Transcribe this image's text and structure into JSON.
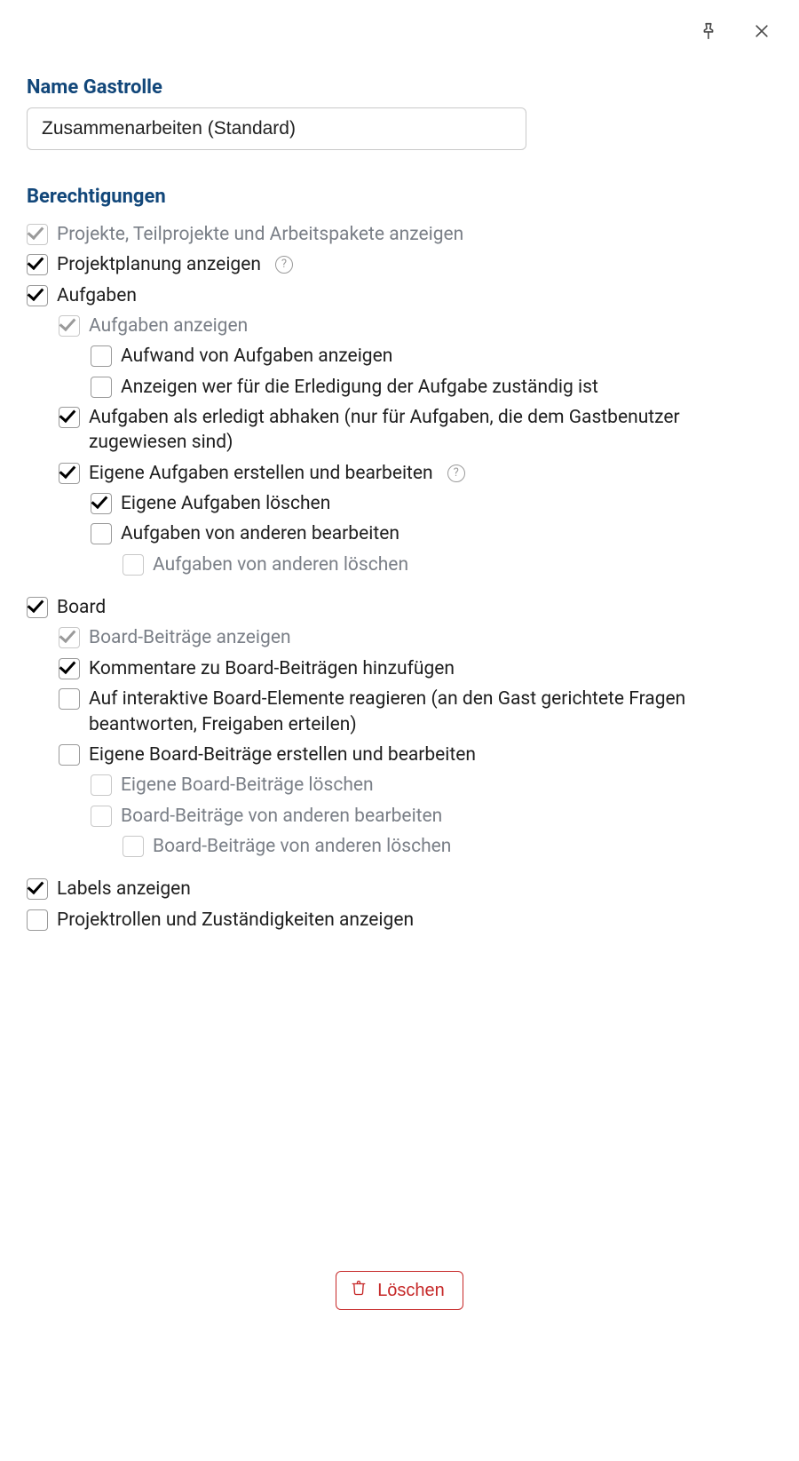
{
  "titlebar": {
    "pin_name": "pin-icon",
    "close_name": "close-icon"
  },
  "name_section": {
    "label": "Name Gastrolle",
    "value": "Zusammenarbeiten (Standard)"
  },
  "perm_section_label": "Berechtigungen",
  "perms": {
    "p0": "Projekte, Teilprojekte und Arbeitspakete anzeigen",
    "p1": "Projektplanung anzeigen",
    "p2": "Aufgaben",
    "p2a": "Aufgaben anzeigen",
    "p2a1": "Aufwand von Aufgaben anzeigen",
    "p2a2": "Anzeigen wer für die Erledigung der Aufgabe zuständig ist",
    "p2b": "Aufgaben als erledigt abhaken (nur für Aufgaben, die dem Gastbenutzer zugewiesen sind)",
    "p2c": "Eigene Aufgaben erstellen und bearbeiten",
    "p2c1": "Eigene Aufgaben löschen",
    "p2c2": "Aufgaben von anderen bearbeiten",
    "p2c2a": "Aufgaben von anderen löschen",
    "p3": "Board",
    "p3a": "Board-Beiträge anzeigen",
    "p3b": "Kommentare zu Board-Beiträgen hinzufügen",
    "p3c": "Auf interaktive Board-Elemente reagieren (an den Gast gerichtete Fragen beantworten, Freigaben erteilen)",
    "p3d": "Eigene Board-Beiträge erstellen und bearbeiten",
    "p3d1": "Eigene Board-Beiträge löschen",
    "p3d2": "Board-Beiträge von anderen bearbeiten",
    "p3d2a": "Board-Beiträge von anderen löschen",
    "p4": "Labels anzeigen",
    "p5": "Projektrollen und Zuständigkeiten anzeigen"
  },
  "footer": {
    "delete_label": "Löschen"
  }
}
